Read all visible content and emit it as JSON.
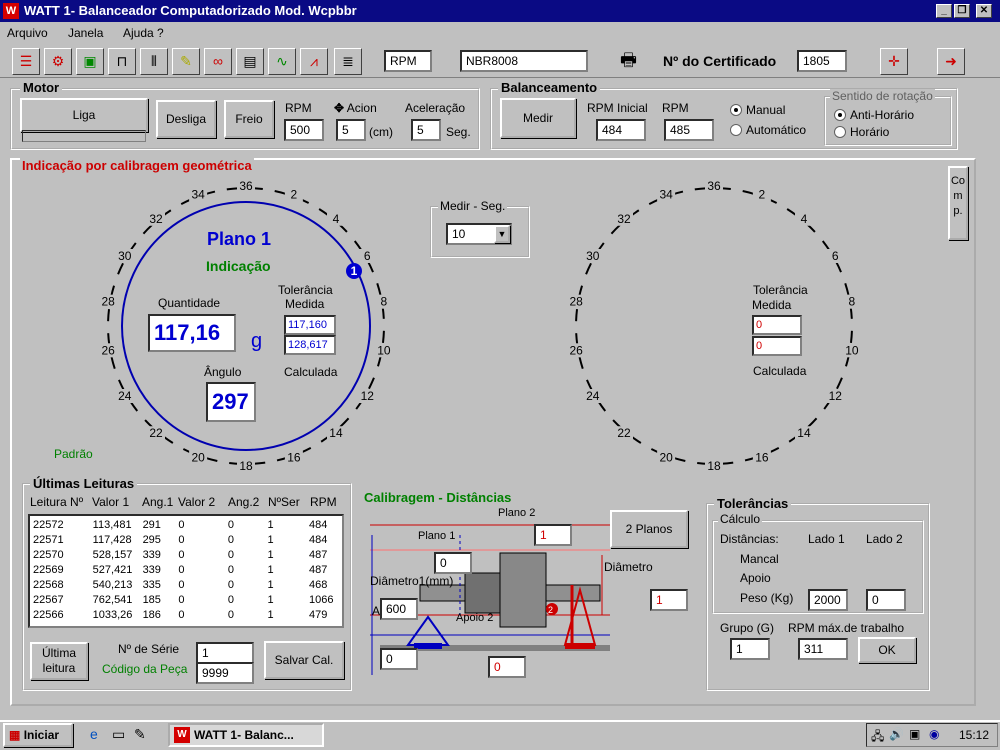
{
  "window": {
    "title": "WATT 1- Balanceador Computadorizado  Mod. Wcpbbr"
  },
  "menu": [
    "Arquivo",
    "Janela",
    "Ajuda ?"
  ],
  "toolbar": {
    "rpm_label": "RPM",
    "norm": "NBR8008",
    "cert_label": "Nº do Certificado",
    "cert_value": "1805"
  },
  "motor": {
    "title": "Motor",
    "liga": "Liga",
    "desliga": "Desliga",
    "freio": "Freio",
    "rpm_label": "RPM",
    "rpm": "500",
    "acion_label": "Acion",
    "acion": "5",
    "acion_unit": "(cm)",
    "acel_label": "Aceleração",
    "acel": "5",
    "acel_unit": "Seg."
  },
  "balanceamento": {
    "title": "Balanceamento",
    "medir": "Medir",
    "rpm_inicial_label": "RPM Inicial",
    "rpm_inicial": "484",
    "rpm_label": "RPM",
    "rpm": "485",
    "manual": "Manual",
    "automatico": "Automático",
    "sentido_title": "Sentido de rotação",
    "anti": "Anti-Horário",
    "horario": "Horário"
  },
  "panel": {
    "title": "Indicação por calibragem geométrica",
    "comp": "Comp.",
    "medir_seg_label": "Medir - Seg.",
    "medir_seg": "10"
  },
  "plano1": {
    "title": "Plano 1",
    "indicacao": "Indicação",
    "quantidade_label": "Quantidade",
    "quantidade": "117,16",
    "unit": "g",
    "angulo_label": "Ângulo",
    "angulo": "297",
    "tol_label": "Tolerância",
    "medida_label": "Medida",
    "medida": "117,160",
    "calculada_val": "128,617",
    "calculada_label": "Calculada",
    "badge": "1",
    "padrao": "Padrão"
  },
  "plano2": {
    "tol_label": "Tolerância",
    "medida_label": "Medida",
    "medida": "0",
    "calculada_val": "0",
    "calculada_label": "Calculada"
  },
  "dial_ticks": [
    "36",
    "34",
    "32",
    "30",
    "28",
    "26",
    "24",
    "22",
    "20",
    "18",
    "16",
    "14",
    "12",
    "10",
    "8",
    "6",
    "4",
    "2"
  ],
  "ultimas": {
    "title": "Últimas Leituras",
    "headers": [
      "Leitura Nº",
      "Valor 1",
      "Ang.1",
      "Valor 2",
      "Ang.2",
      "NºSer",
      "RPM"
    ],
    "rows": [
      [
        "22572",
        "113,481",
        "291",
        "0",
        "0",
        "1",
        "484"
      ],
      [
        "22571",
        "117,428",
        "295",
        "0",
        "0",
        "1",
        "484"
      ],
      [
        "22570",
        "528,157",
        "339",
        "0",
        "0",
        "1",
        "487"
      ],
      [
        "22569",
        "527,421",
        "339",
        "0",
        "0",
        "1",
        "487"
      ],
      [
        "22568",
        "540,213",
        "335",
        "0",
        "0",
        "1",
        "468"
      ],
      [
        "22567",
        "762,541",
        "185",
        "0",
        "0",
        "1",
        "1066"
      ],
      [
        "22566",
        "1033,26",
        "186",
        "0",
        "0",
        "1",
        "479"
      ]
    ],
    "ultima_btn": "Última leitura",
    "serie_label": "Nº de Série",
    "serie": "1",
    "codigo_label": "Código da Peça",
    "codigo": "9999",
    "salvar": "Salvar Cal."
  },
  "calib": {
    "title": "Calibragem - Distâncias",
    "plano2": "Plano 2",
    "plano2_val": "1",
    "plano1": "Plano 1",
    "plano1_val": "0",
    "diametro1": "Diâmetro1(mm)",
    "a_label": "A",
    "a_val": "600",
    "apoio2": "Apoio 2",
    "apoio_val": "0",
    "bottom_val": "0",
    "diametro": "Diâmetro",
    "diametro_val": "1",
    "dois_planos": "2 Planos",
    "m1": "1",
    "m2": "2"
  },
  "tol": {
    "title": "Tolerâncias",
    "calculo": "Cálculo",
    "distancias": "Distâncias:",
    "lado1": "Lado 1",
    "lado2": "Lado 2",
    "mancal": "Mancal",
    "apoio": "Apoio",
    "peso": "Peso (Kg)",
    "peso1": "2000",
    "peso2": "0",
    "grupo_label": "Grupo (G)",
    "grupo": "1",
    "rpm_max_label": "RPM máx.de trabalho",
    "rpm_max": "311",
    "ok": "OK"
  },
  "taskbar": {
    "start": "Iniciar",
    "task": "WATT 1- Balanc...",
    "clock": "15:12"
  }
}
